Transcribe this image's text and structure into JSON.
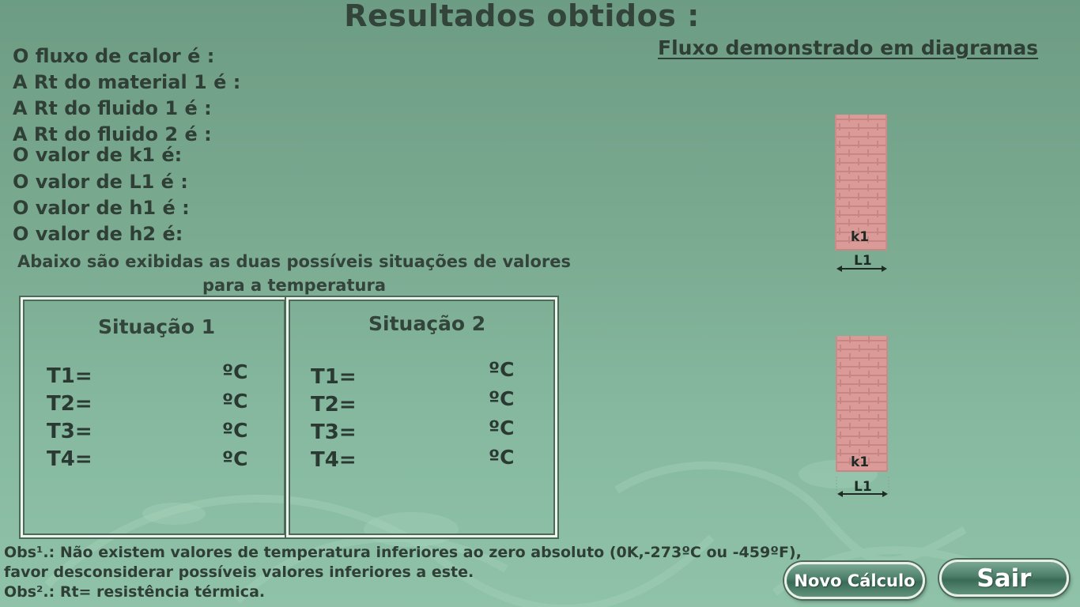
{
  "title": "Resultados obtidos :",
  "diagram_heading": "Fluxo demonstrado em diagramas",
  "results": [
    "O fluxo de calor é :",
    "A Rt do material 1 é :",
    "A Rt do fluido 1 é :",
    "A Rt do fluido 2 é :",
    "O valor de k1 é:",
    "O valor de L1 é :",
    "O valor de h1 é :",
    "O valor de h2 é:"
  ],
  "note_line1": "Abaixo são exibidas as duas possíveis situações de valores",
  "note_line2": "para a temperatura",
  "situations": [
    {
      "title": "Situação 1",
      "temps": [
        {
          "label": "T1=",
          "unit": "ºC"
        },
        {
          "label": "T2=",
          "unit": "ºC"
        },
        {
          "label": "T3=",
          "unit": "ºC"
        },
        {
          "label": "T4=",
          "unit": "ºC"
        }
      ]
    },
    {
      "title": "Situação 2",
      "temps": [
        {
          "label": "T1=",
          "unit": "ºC"
        },
        {
          "label": "T2=",
          "unit": "ºC"
        },
        {
          "label": "T3=",
          "unit": "ºC"
        },
        {
          "label": "T4=",
          "unit": "ºC"
        }
      ]
    }
  ],
  "diagrams": [
    {
      "material_label": "k1",
      "thickness_label": "L1"
    },
    {
      "material_label": "k1",
      "thickness_label": "L1"
    }
  ],
  "obs1_line1": "Obs¹.: Não existem valores de temperatura inferiores ao zero absoluto (0K,-273ºC ou -459ºF),",
  "obs1_line2": "favor desconsiderar possíveis valores inferiores a este.",
  "obs2": "Obs².: Rt= resistência térmica.",
  "buttons": {
    "novo_calculo": "Novo Cálculo",
    "sair": "Sair"
  },
  "colors": {
    "background": "#79a98f",
    "brick": "#d99a98",
    "button": "#4b7d68"
  }
}
